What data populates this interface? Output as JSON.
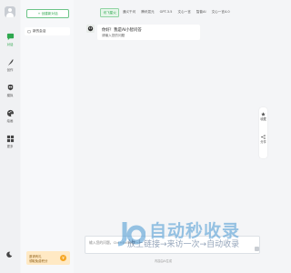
{
  "rail": {
    "items": [
      {
        "label": "对话",
        "icon": "chat-bubble-icon",
        "active": true
      },
      {
        "label": "创作",
        "icon": "feather-pen-icon",
        "active": false
      },
      {
        "label": "模拟",
        "icon": "mask-icon",
        "active": false
      },
      {
        "label": "绘画",
        "icon": "palette-icon",
        "active": false
      },
      {
        "label": "更多",
        "icon": "grid-icon",
        "active": false
      }
    ]
  },
  "sidebar": {
    "new_chat_label": "+ 创建新对话",
    "chat_item_label": "新的会话",
    "promo_line1": "邀请有礼",
    "promo_line2": "领取免费积分",
    "promo_coin": "¥"
  },
  "tabs": [
    "讯飞星火",
    "通义千问",
    "腾讯混元",
    "GPT-3.5",
    "文心一言",
    "智普AI",
    "文心一言4.0"
  ],
  "message": {
    "title": "你好！我是AI小智问答",
    "subtitle": "请输入您的问题"
  },
  "float_bar": {
    "items": [
      {
        "label": "收藏",
        "icon": "star-icon"
      },
      {
        "label": "分享",
        "icon": "share-icon"
      }
    ]
  },
  "input": {
    "placeholder": "输入您的问题，Ctrl+Enter换行"
  },
  "disclaimer": "内容由AI生成",
  "watermark": {
    "title": "自动秒收录",
    "subtitle": "放上链接→来访一次→自动收录"
  },
  "colors": {
    "accent": "#2fa84f",
    "promo_bg": "#ffe9c4"
  }
}
